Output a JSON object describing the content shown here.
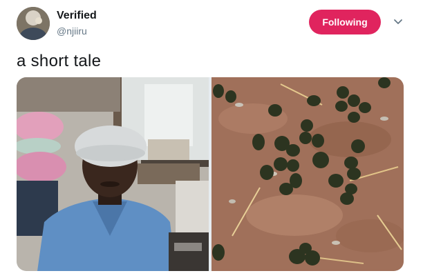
{
  "tweet": {
    "author": {
      "display_name": "Verified",
      "handle": "@njiiru",
      "avatar_icon": "user-avatar"
    },
    "follow_button": {
      "label": "Following",
      "color": "#e0245e"
    },
    "menu_icon": "chevron-down-icon",
    "text": "a short tale",
    "media": [
      {
        "description_icon": "photo-of-man-in-hairnet"
      },
      {
        "description_icon": "photo-of-dung-pellets-on-soil"
      }
    ]
  },
  "colors": {
    "text_primary": "#14171a",
    "text_secondary": "#657786",
    "accent": "#e0245e"
  }
}
